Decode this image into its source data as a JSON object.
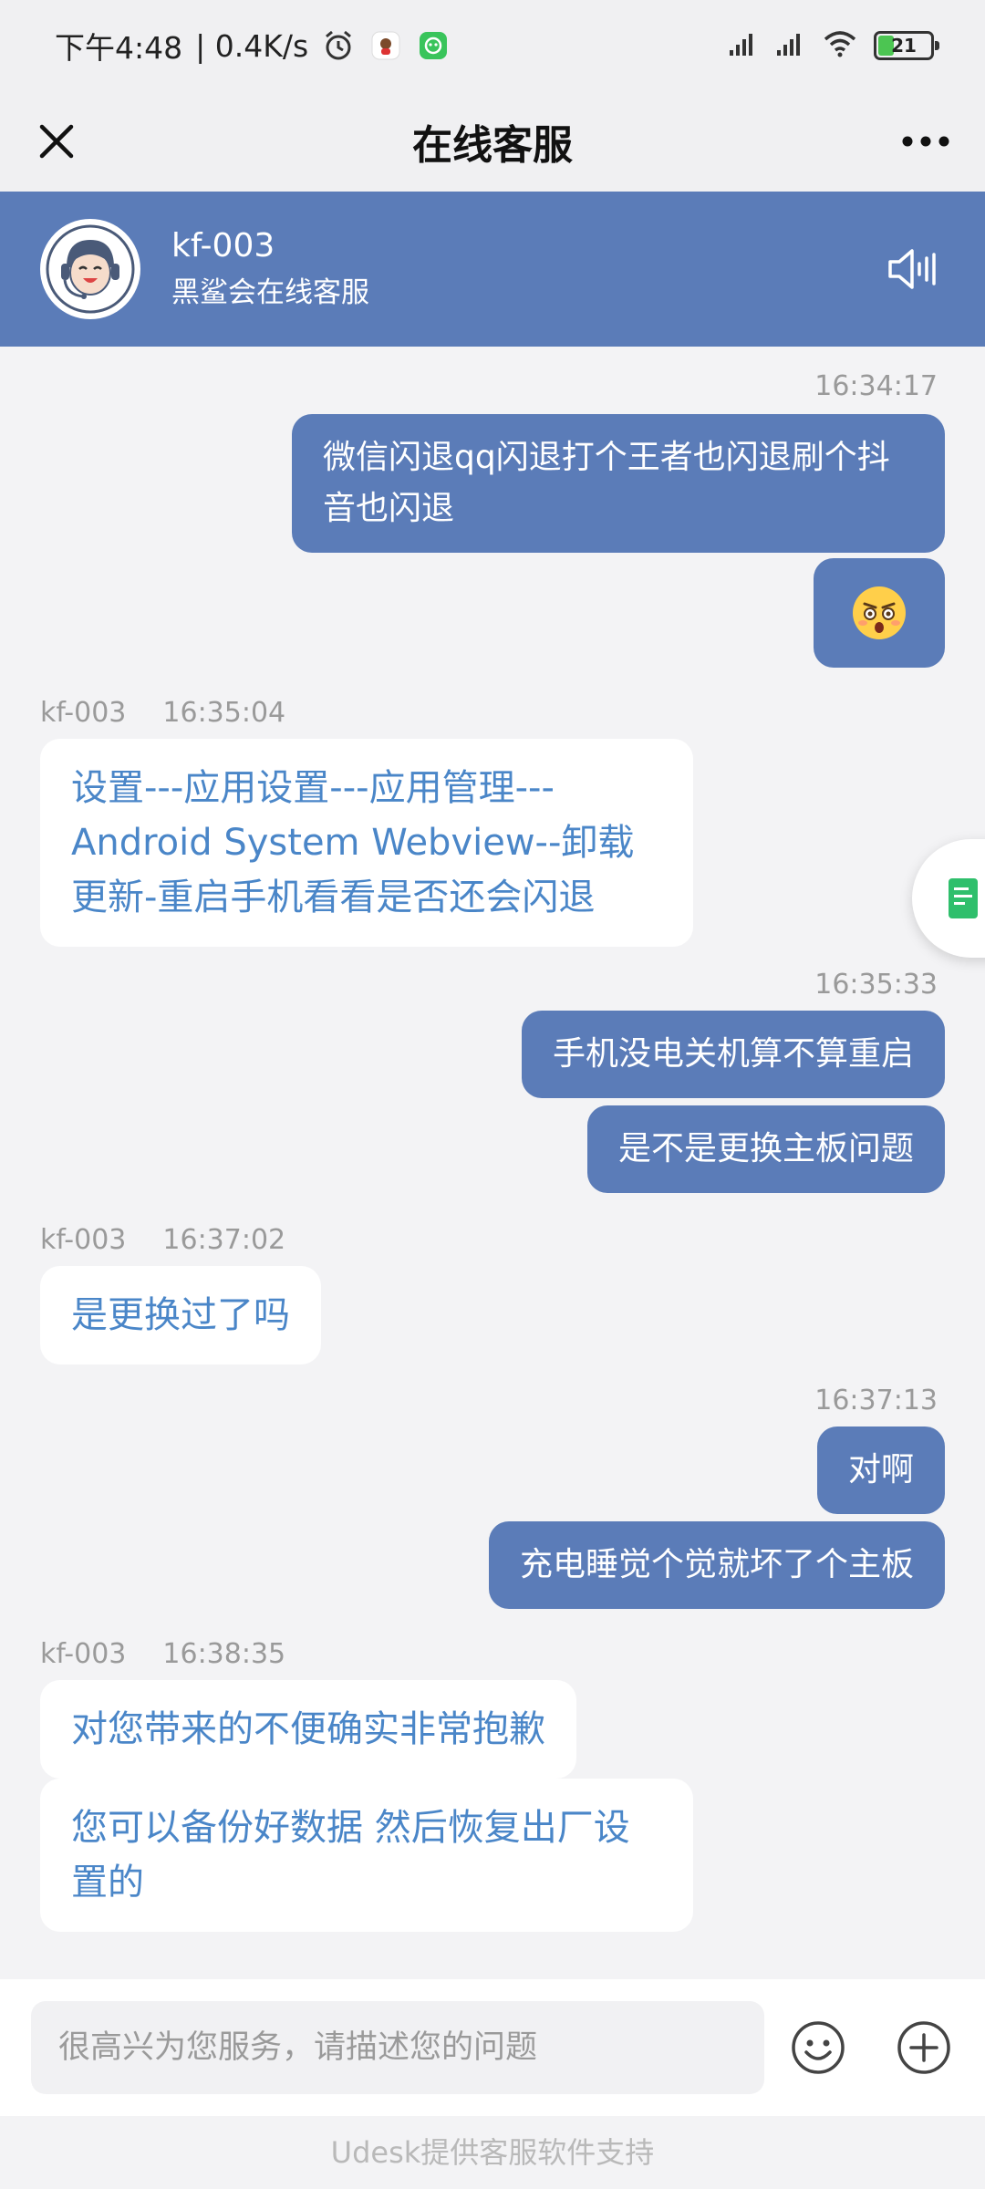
{
  "status_bar": {
    "time": "下午4:48",
    "network_speed": "| 0.4K/s",
    "battery_level": "21",
    "icons": [
      "alarm-icon",
      "app-notification-icon",
      "wechat-style-notification-icon",
      "signal-icon",
      "signal-icon",
      "wifi-icon",
      "battery-icon"
    ]
  },
  "titlebar": {
    "title": "在线客服",
    "close_icon": "close-icon",
    "more_icon": "more-icon"
  },
  "agent": {
    "name": "kf-003",
    "org": "黑鲨会在线客服",
    "speaker_icon": "speaker-icon"
  },
  "messages": [
    {
      "type": "timestamp_right",
      "time": "16:34:17"
    },
    {
      "type": "me",
      "text": "微信闪退qq闪退打个王者也闪退刷个抖音也闪退"
    },
    {
      "type": "me_emoji",
      "emoji": "😳"
    },
    {
      "type": "timestamp_left",
      "sender": "kf-003",
      "time": "16:35:04"
    },
    {
      "type": "agent",
      "text": "设置---应用设置---应用管理---Android System Webview--卸载更新-重启手机看看是否还会闪退"
    },
    {
      "type": "timestamp_right",
      "time": "16:35:33"
    },
    {
      "type": "me",
      "text": "手机没电关机算不算重启"
    },
    {
      "type": "me",
      "text": "是不是更换主板问题"
    },
    {
      "type": "timestamp_left",
      "sender": "kf-003",
      "time": "16:37:02"
    },
    {
      "type": "agent",
      "text": "是更换过了吗"
    },
    {
      "type": "timestamp_right",
      "time": "16:37:13"
    },
    {
      "type": "me",
      "text": "对啊"
    },
    {
      "type": "me",
      "text": "充电睡觉个觉就坏了个主板"
    },
    {
      "type": "timestamp_left",
      "sender": "kf-003",
      "time": "16:38:35"
    },
    {
      "type": "agent",
      "text": "对您带来的不便确实非常抱歉"
    },
    {
      "type": "agent",
      "text": "您可以备份好数据 然后恢复出厂设置的"
    }
  ],
  "input": {
    "placeholder": "很高兴为您服务，请描述您的问题",
    "value": ""
  },
  "footer": {
    "text": "Udesk提供客服软件支持"
  },
  "colors": {
    "brand_blue": "#5b7cb8",
    "agent_text": "#4a86c8",
    "background": "#f3f3f5"
  }
}
